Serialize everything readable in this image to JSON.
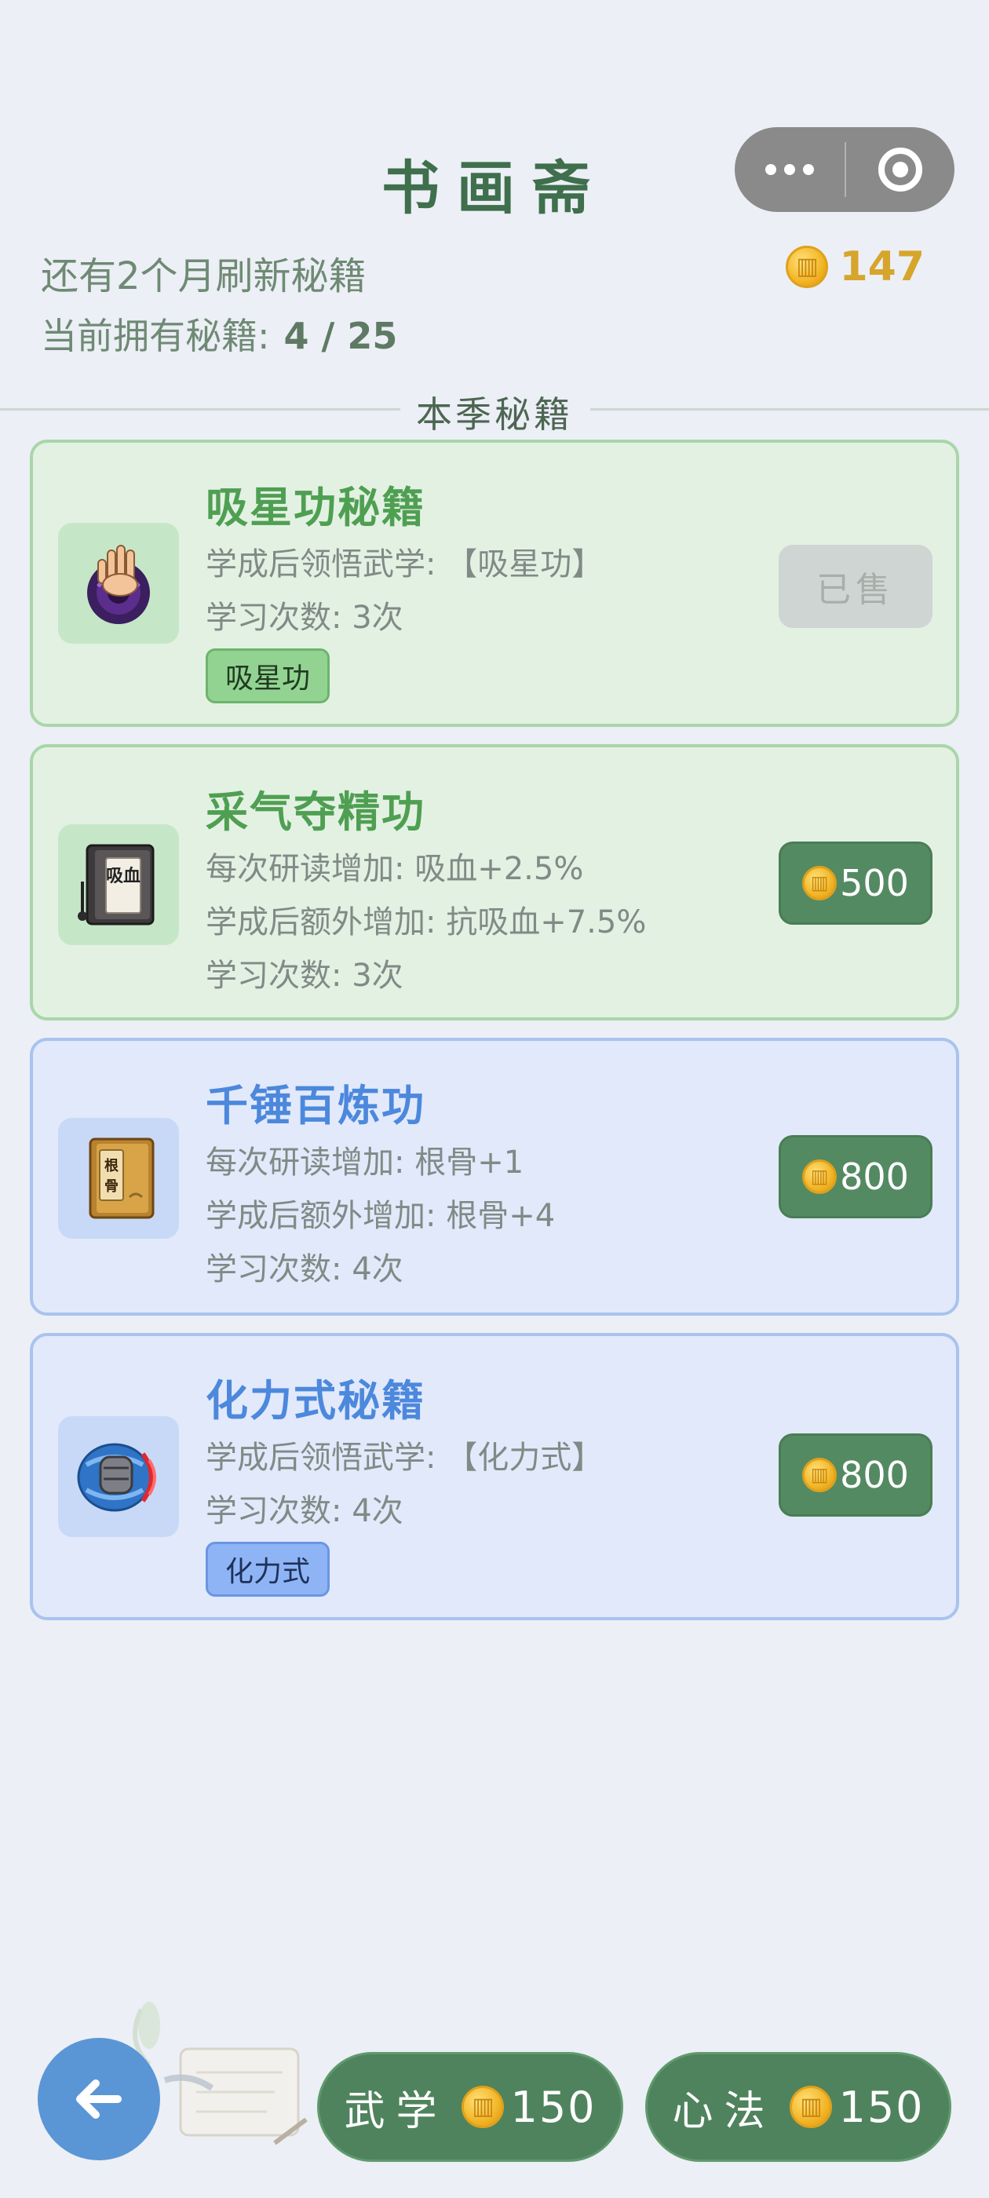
{
  "header": {
    "title": "书画斋",
    "refresh_text": "还有2个月刷新秘籍",
    "owned_label": "当前拥有秘籍:",
    "owned_value": "4 / 25",
    "coins": "147",
    "capsule": {
      "more_icon": "more-dots-icon",
      "close_icon": "target-close-icon"
    }
  },
  "section": {
    "title": "本季秘籍"
  },
  "books": [
    {
      "name": "吸星功秘籍",
      "lines": [
        "学成后领悟武学: 【吸星功】",
        "学习次数: 3次"
      ],
      "tag": "吸星功",
      "button": "已售",
      "sold": true,
      "theme": "green",
      "icon": "swirl-hand-icon"
    },
    {
      "name": "采气夺精功",
      "lines": [
        "每次研读增加: 吸血+2.5%",
        "学成后额外增加: 抗吸血+7.5%",
        "学习次数: 3次"
      ],
      "price": "500",
      "theme": "green",
      "icon": "book-xixue-icon",
      "icon_text": "吸血"
    },
    {
      "name": "千锤百炼功",
      "lines": [
        "每次研读增加: 根骨+1",
        "学成后额外增加: 根骨+4",
        "学习次数: 4次"
      ],
      "price": "800",
      "theme": "blue",
      "icon": "book-gengu-icon",
      "icon_text": "根骨"
    },
    {
      "name": "化力式秘籍",
      "lines": [
        "学成后领悟武学: 【化力式】",
        "学习次数: 4次"
      ],
      "tag": "化力式",
      "price": "800",
      "theme": "blue",
      "icon": "shield-fist-icon"
    }
  ],
  "footer": {
    "back_icon": "back-arrow-icon",
    "wuxue_label": "武学",
    "wuxue_price": "150",
    "xinfa_label": "心法",
    "xinfa_price": "150"
  },
  "colors": {
    "title": "#3f6f4c",
    "coin_amount": "#d6a52c",
    "buy_button": "#548a62",
    "green_name": "#4f9f52",
    "blue_name": "#4c88dc",
    "back_button": "#5a96d6"
  }
}
